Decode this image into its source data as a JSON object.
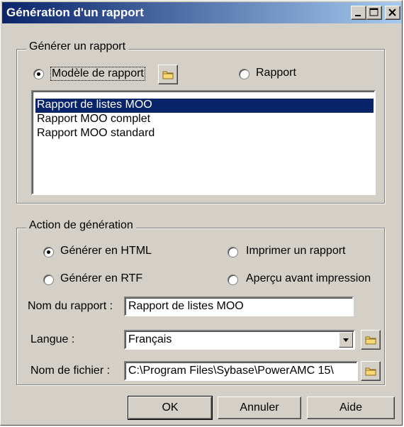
{
  "window": {
    "title": "Génération d'un rapport",
    "controls": [
      "minimize-icon",
      "maximize-icon",
      "close-icon"
    ]
  },
  "generate_group": {
    "legend": "Générer un rapport",
    "options": [
      {
        "label": "Modèle de rapport",
        "checked": true
      },
      {
        "label": "Rapport",
        "checked": false
      }
    ],
    "list_items": [
      {
        "label": "Rapport de listes MOO",
        "selected": true
      },
      {
        "label": "Rapport MOO complet",
        "selected": false
      },
      {
        "label": "Rapport MOO standard",
        "selected": false
      }
    ]
  },
  "action_group": {
    "legend": "Action de génération",
    "options": [
      {
        "label": "Générer en HTML",
        "checked": true
      },
      {
        "label": "Imprimer un rapport",
        "checked": false
      },
      {
        "label": "Générer en RTF",
        "checked": false
      },
      {
        "label": "Aperçu avant impression",
        "checked": false
      }
    ],
    "report_name_label": "Nom du rapport :",
    "report_name_value": "Rapport de listes MOO",
    "language_label": "Langue :",
    "language_value": "Français",
    "filename_label": "Nom de fichier :",
    "filename_value": "C:\\Program Files\\Sybase\\PowerAMC 15\\"
  },
  "buttons": {
    "ok": "OK",
    "cancel": "Annuler",
    "help": "Aide"
  },
  "colors": {
    "titlebar_start": "#0a246a",
    "titlebar_end": "#a6caf0",
    "face": "#d4d0c8",
    "selection": "#0a246a"
  }
}
